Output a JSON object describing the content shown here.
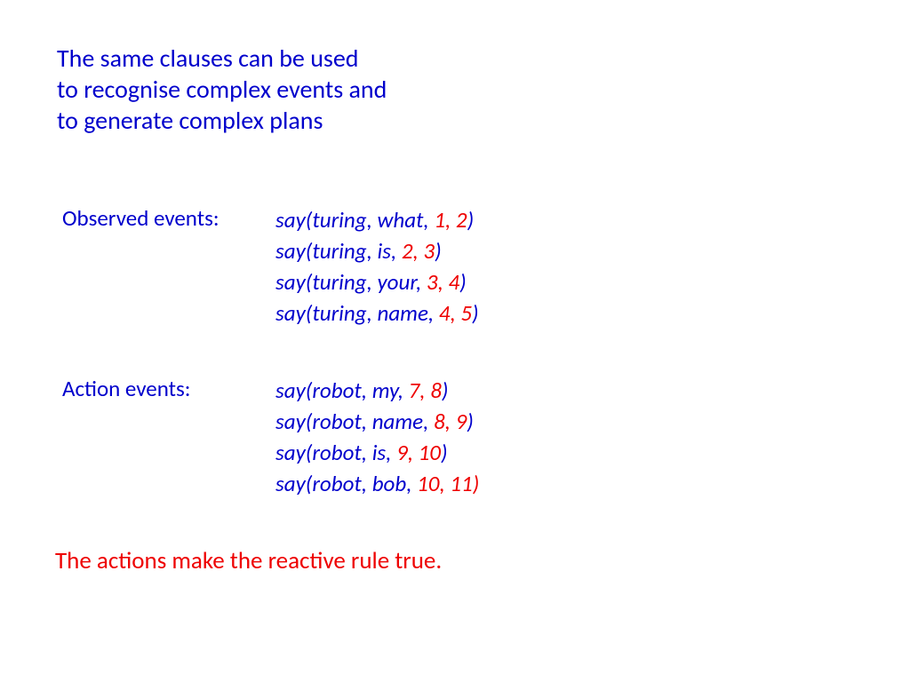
{
  "title_line1": "The same clauses can be used",
  "title_line2": "to recognise complex events and",
  "title_line3": "to generate complex plans",
  "observed_label": "Observed events:",
  "observed": [
    {
      "prefix": "say(turing, what, ",
      "nums": "1, 2",
      "suffix": ")"
    },
    {
      "prefix": "say(turing, is,  ",
      "nums": "2, 3",
      "suffix": ")"
    },
    {
      "prefix": "say(turing, your, ",
      "nums": "3,  4",
      "suffix": ")"
    },
    {
      "prefix": "say(turing, name, ",
      "nums": "4, 5",
      "suffix": ")"
    }
  ],
  "action_label": "Action events:",
  "actions": [
    {
      "prefix": "say(robot, my, ",
      "nums": "7, 8",
      "suffix": ")"
    },
    {
      "prefix": "say(robot, name, ",
      "nums": "8, 9",
      "suffix": ")"
    },
    {
      "prefix": "say(robot, is, ",
      "nums": "9, 10",
      "suffix": ")"
    },
    {
      "prefix": "say(robot, bob, ",
      "nums": "10, 11)",
      "suffix": ""
    }
  ],
  "footer": "The actions make the reactive rule true."
}
